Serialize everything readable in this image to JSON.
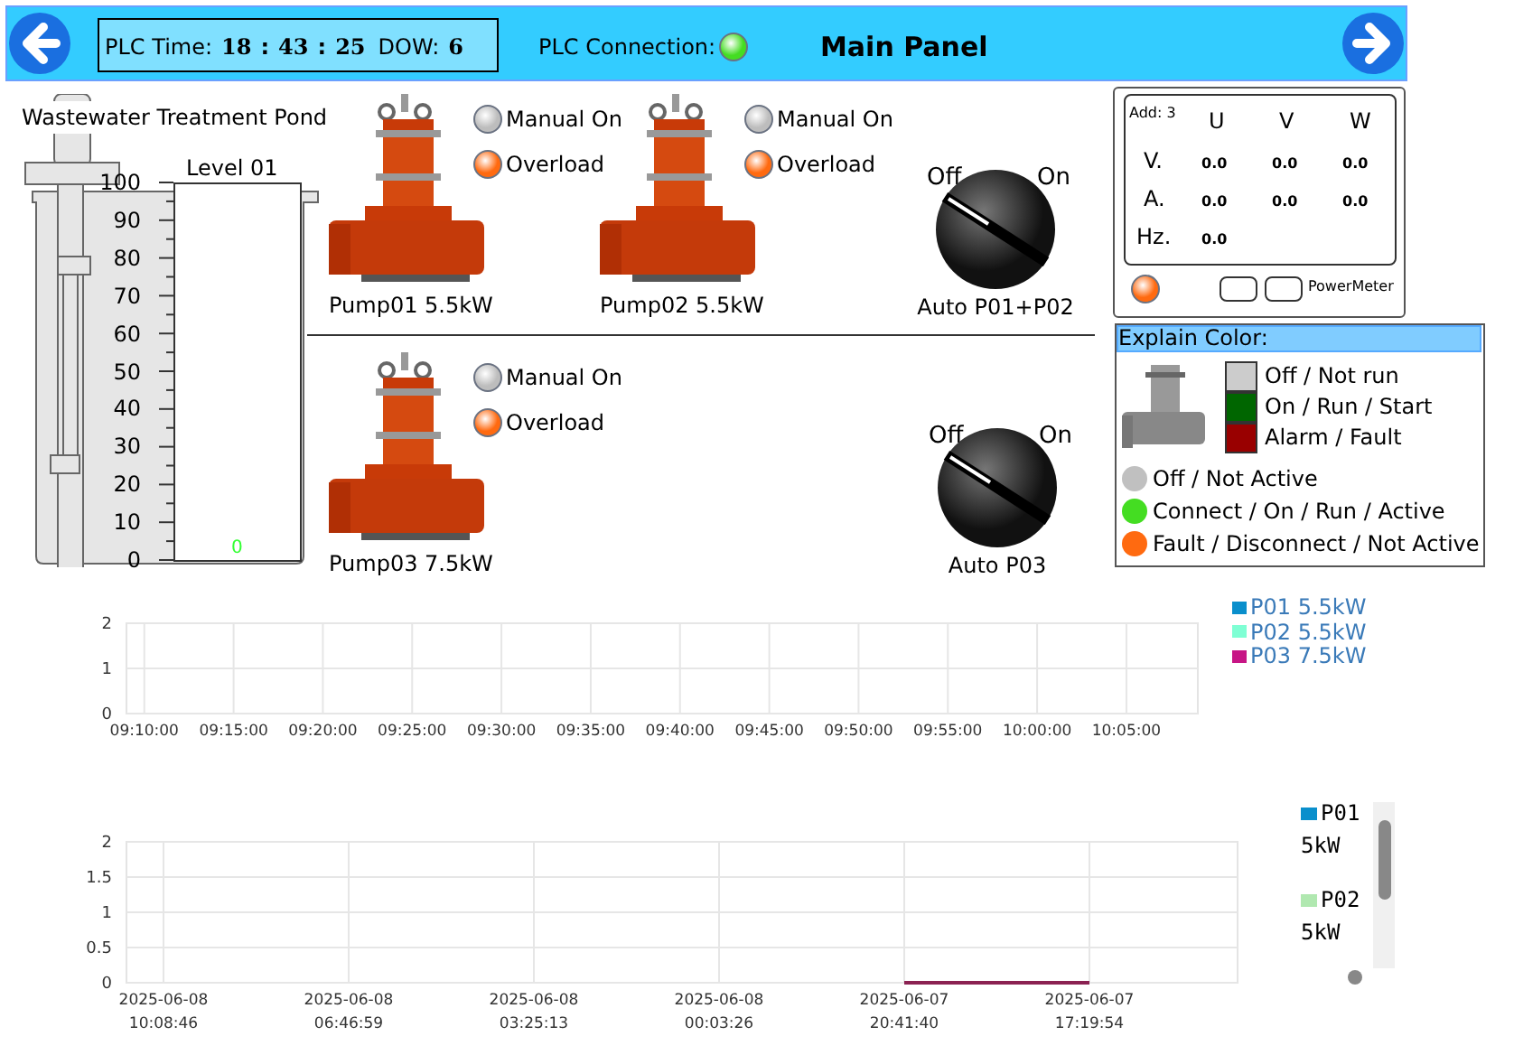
{
  "header": {
    "title": "Main Panel",
    "plc_time_label": "PLC Time:",
    "hour": "18",
    "sep1": ":",
    "minute": "43",
    "sep2": ":",
    "second": "25",
    "dow_label": "DOW:",
    "dow": "6",
    "connection_label": "PLC Connection:",
    "connected": true
  },
  "tank": {
    "title": "Wastewater Treatment Pond",
    "label": "Level 01",
    "scale": [
      "100",
      "90",
      "80",
      "70",
      "60",
      "50",
      "40",
      "30",
      "20",
      "10",
      "0"
    ],
    "reading": "0",
    "level": 0
  },
  "pumps": [
    {
      "label": "Pump01 5.5kW",
      "manual_label": "Manual On",
      "manual_on": false,
      "overload_label": "Overload",
      "overload": true
    },
    {
      "label": "Pump02 5.5kW",
      "manual_label": "Manual On",
      "manual_on": false,
      "overload_label": "Overload",
      "overload": true
    },
    {
      "label": "Pump03 7.5kW",
      "manual_label": "Manual On",
      "manual_on": false,
      "overload_label": "Overload",
      "overload": true
    }
  ],
  "switches": [
    {
      "off_label": "Off",
      "on_label": "On",
      "label": "Auto P01+P02",
      "on": false
    },
    {
      "off_label": "Off",
      "on_label": "On",
      "label": "Auto P03",
      "on": false
    }
  ],
  "power_meter": {
    "address": "Add: 3",
    "columns": [
      "U",
      "V",
      "W"
    ],
    "rows": [
      {
        "label": "V.",
        "values": [
          "0.0",
          "0.0",
          "0.0"
        ]
      },
      {
        "label": "A.",
        "values": [
          "0.0",
          "0.0",
          "0.0"
        ]
      },
      {
        "label": "Hz.",
        "values": [
          "0.0"
        ]
      }
    ],
    "fault": true,
    "label": "PowerMeter"
  },
  "legend": {
    "title": "Explain Color:",
    "swatches": [
      {
        "label": "Off / Not run",
        "color": "#cccccc"
      },
      {
        "label": "On / Run / Start",
        "color": "#006600"
      },
      {
        "label": "Alarm / Fault",
        "color": "#990000"
      }
    ],
    "lamps": [
      {
        "label": "Off / Not Active",
        "color": "#c0c0c0"
      },
      {
        "label": "Connect / On / Run / Active",
        "color": "#44dd22"
      },
      {
        "label": "Fault / Disconnect / Not Active",
        "color": "#ff6a10"
      }
    ]
  },
  "chart_top": {
    "chart_data": {
      "type": "line",
      "categories": [
        "09:10:00",
        "09:15:00",
        "09:20:00",
        "09:25:00",
        "09:30:00",
        "09:35:00",
        "09:40:00",
        "09:45:00",
        "09:50:00",
        "09:55:00",
        "10:00:00",
        "10:05:00"
      ],
      "yticks": [
        0,
        1,
        2
      ],
      "ylim": [
        0,
        2
      ],
      "grid": true,
      "series": [
        {
          "name": "P01 5.5kW",
          "color": "#0a8fcc",
          "values": [
            null,
            null,
            null,
            null,
            null,
            null,
            null,
            null,
            null,
            null,
            null,
            null
          ]
        },
        {
          "name": "P02 5.5kW",
          "color": "#7fffd4",
          "values": [
            null,
            null,
            null,
            null,
            null,
            null,
            null,
            null,
            null,
            null,
            null,
            null
          ]
        },
        {
          "name": "P03 7.5kW",
          "color": "#c71585",
          "values": [
            null,
            null,
            null,
            null,
            null,
            null,
            null,
            null,
            null,
            null,
            null,
            null
          ]
        }
      ]
    }
  },
  "chart_bottom": {
    "legend": [
      {
        "name": "P01",
        "second_line": "5kW",
        "color": "#0a8fcc"
      },
      {
        "name": "P02",
        "second_line": "5kW",
        "color": "#b0e8b0"
      }
    ],
    "chart_data": {
      "type": "line",
      "categories": [
        "2025-06-08 10:08:46",
        "2025-06-08 06:46:59",
        "2025-06-08 03:25:13",
        "2025-06-08 00:03:26",
        "2025-06-07 20:41:40",
        "2025-06-07 17:19:54"
      ],
      "yticks": [
        0,
        0.5,
        1,
        1.5,
        2
      ],
      "ylim": [
        0,
        2
      ],
      "grid": true,
      "series": [
        {
          "color": "#8b2252",
          "values": [
            null,
            null,
            null,
            null,
            0,
            0
          ]
        }
      ]
    }
  }
}
